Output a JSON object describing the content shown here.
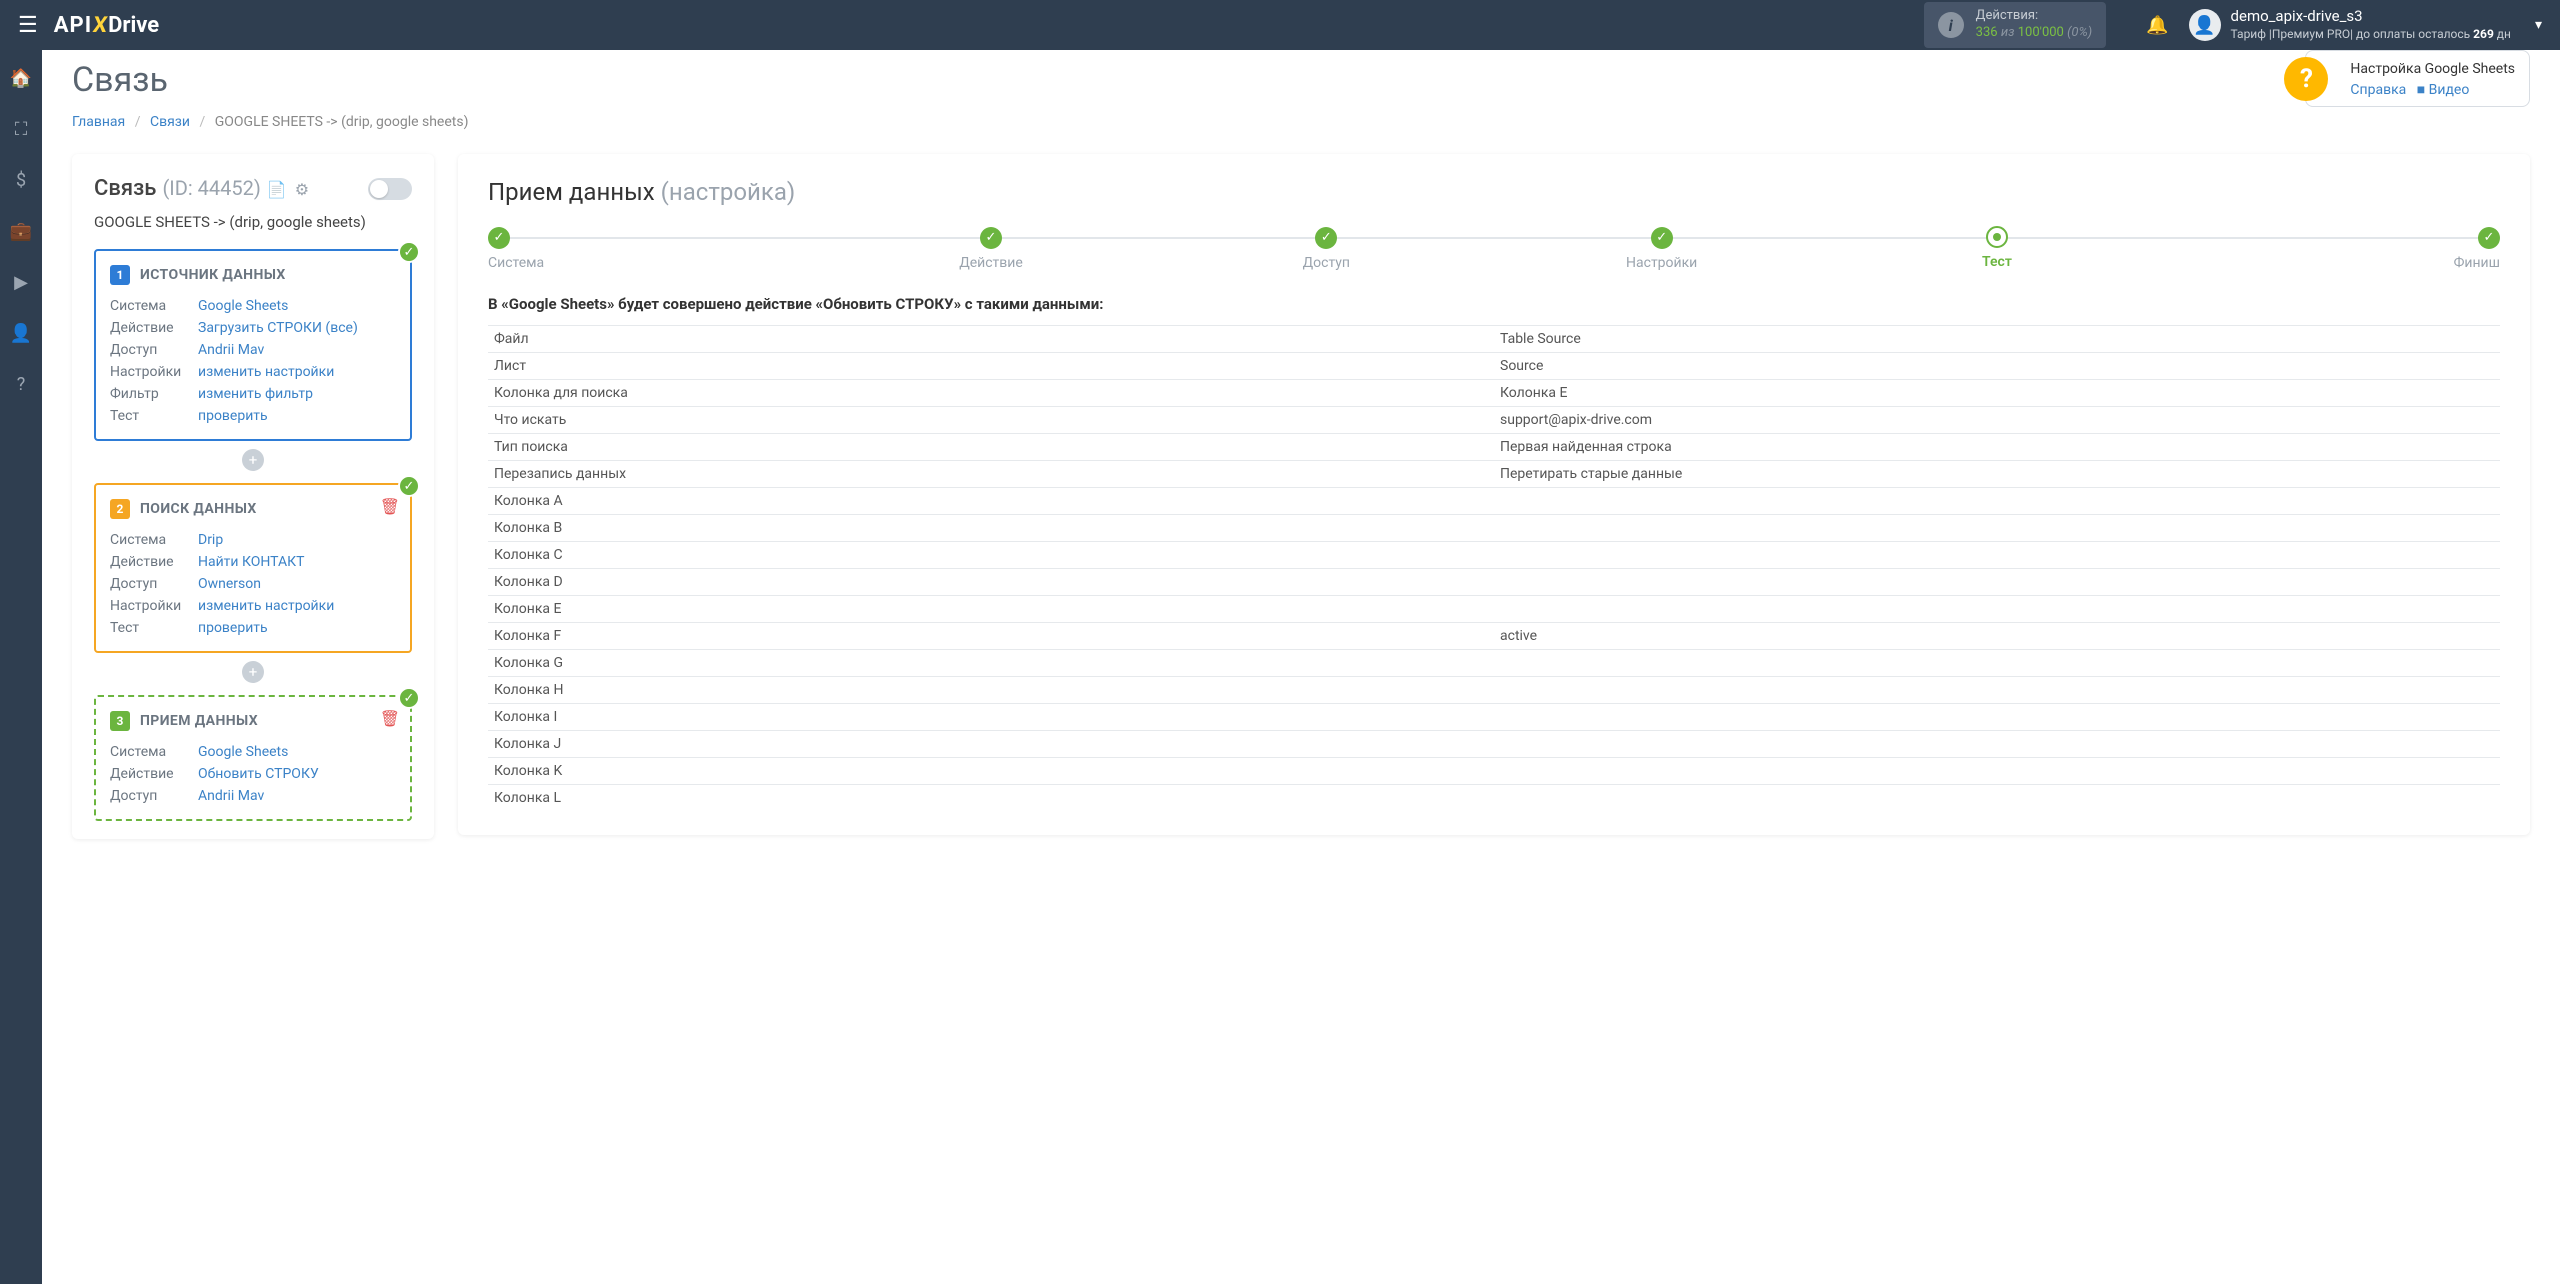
{
  "topbar": {
    "actions_label": "Действия:",
    "actions_count": "336",
    "actions_iz": "из",
    "actions_limit": "100'000",
    "actions_pct": "(0%)"
  },
  "user": {
    "name": "demo_apix-drive_s3",
    "tarif_prefix": "Тариф |Премиум PRO| до оплаты осталось ",
    "days": "269",
    "days_suffix": " дн"
  },
  "page": {
    "title": "Связь",
    "bc_home": "Главная",
    "bc_links": "Связи",
    "bc_current": "GOOGLE SHEETS -> (drip, google sheets)"
  },
  "help": {
    "title": "Настройка Google Sheets",
    "link_ref": "Справка",
    "link_video": "Видео"
  },
  "panel": {
    "title": "Связь",
    "id": "(ID: 44452)",
    "sub": "GOOGLE SHEETS -> (drip, google sheets)",
    "lbl_system": "Система",
    "lbl_action": "Действие",
    "lbl_access": "Доступ",
    "lbl_settings": "Настройки",
    "lbl_filter": "Фильтр",
    "lbl_test": "Тест",
    "src": {
      "num": "1",
      "title": "ИСТОЧНИК ДАННЫХ",
      "system": "Google Sheets",
      "action": "Загрузить СТРОКИ (все)",
      "access": "Andrii Mav",
      "settings": "изменить настройки",
      "filter": "изменить фильтр",
      "test": "проверить"
    },
    "search": {
      "num": "2",
      "title": "ПОИСК ДАННЫХ",
      "system": "Drip",
      "action": "Найти КОНТАКТ",
      "access": "Ownerson",
      "settings": "изменить настройки",
      "test": "проверить"
    },
    "dest": {
      "num": "3",
      "title": "ПРИЕМ ДАННЫХ",
      "system": "Google Sheets",
      "action": "Обновить СТРОКУ",
      "access": "Andrii Mav"
    }
  },
  "right": {
    "title": "Прием данных",
    "title_cfg": "(настройка)",
    "steps": [
      {
        "label": "Система",
        "state": "done"
      },
      {
        "label": "Действие",
        "state": "done"
      },
      {
        "label": "Доступ",
        "state": "done"
      },
      {
        "label": "Настройки",
        "state": "done"
      },
      {
        "label": "Тест",
        "state": "current"
      },
      {
        "label": "Финиш",
        "state": "done"
      }
    ],
    "action_text": "В «Google Sheets» будет совершено действие «Обновить СТРОКУ» с такими данными:",
    "rows": [
      {
        "k": "Файл",
        "v": "Table Source"
      },
      {
        "k": "Лист",
        "v": "Source"
      },
      {
        "k": "Колонка для поиска",
        "v": "Колонка E"
      },
      {
        "k": "Что искать",
        "v": "support@apix-drive.com"
      },
      {
        "k": "Тип поиска",
        "v": "Первая найденная строка"
      },
      {
        "k": "Перезапись данных",
        "v": "Перетирать старые данные"
      },
      {
        "k": "Колонка A",
        "v": ""
      },
      {
        "k": "Колонка B",
        "v": ""
      },
      {
        "k": "Колонка C",
        "v": ""
      },
      {
        "k": "Колонка D",
        "v": ""
      },
      {
        "k": "Колонка E",
        "v": ""
      },
      {
        "k": "Колонка F",
        "v": "active"
      },
      {
        "k": "Колонка G",
        "v": ""
      },
      {
        "k": "Колонка H",
        "v": ""
      },
      {
        "k": "Колонка I",
        "v": ""
      },
      {
        "k": "Колонка J",
        "v": ""
      },
      {
        "k": "Колонка K",
        "v": ""
      },
      {
        "k": "Колонка L",
        "v": ""
      }
    ]
  }
}
